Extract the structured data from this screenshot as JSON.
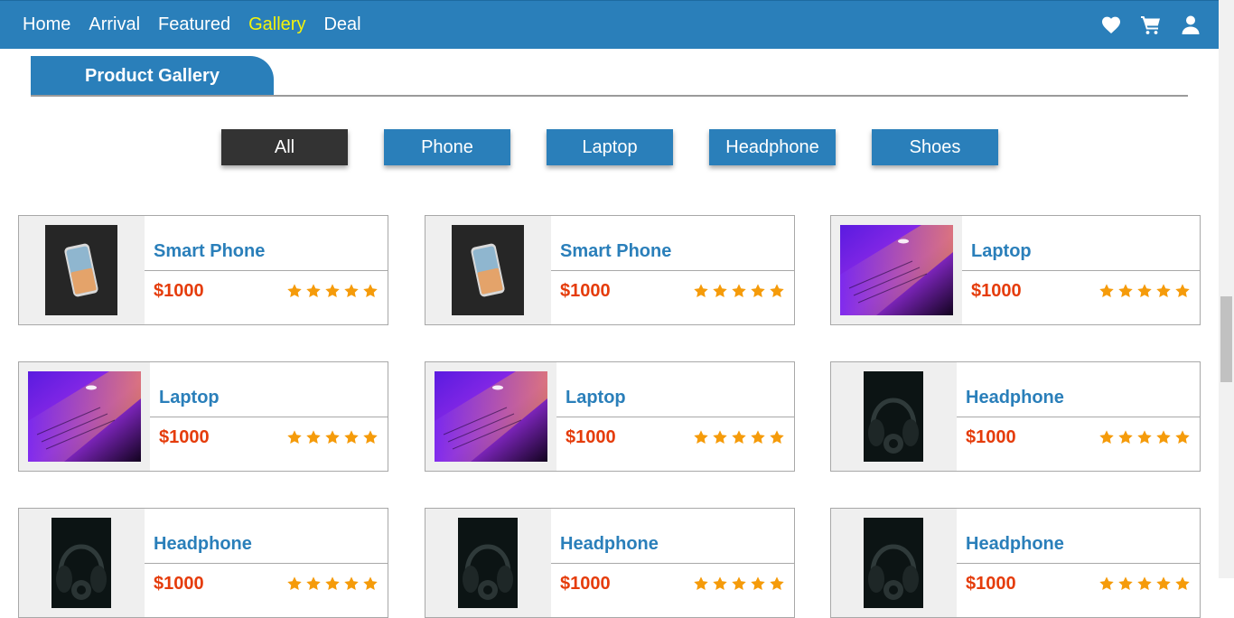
{
  "nav": {
    "links": [
      "Home",
      "Arrival",
      "Featured",
      "Gallery",
      "Deal"
    ],
    "active": "Gallery",
    "icons": [
      "heart-icon",
      "cart-icon",
      "user-icon"
    ]
  },
  "gallery": {
    "title": "Product Gallery"
  },
  "filters": {
    "items": [
      "All",
      "Phone",
      "Laptop",
      "Headphone",
      "Shoes"
    ],
    "active": "All"
  },
  "colors": {
    "brand": "#2a7fba",
    "active_nav": "#f3f30b",
    "price": "#e53c0b",
    "star": "#f59b0a",
    "dark_button": "#333333"
  },
  "products": [
    {
      "name": "Smart Phone",
      "price": "$1000",
      "rating": 5,
      "image": "phone"
    },
    {
      "name": "Smart Phone",
      "price": "$1000",
      "rating": 5,
      "image": "phone"
    },
    {
      "name": "Laptop",
      "price": "$1000",
      "rating": 5,
      "image": "laptop"
    },
    {
      "name": "Laptop",
      "price": "$1000",
      "rating": 5,
      "image": "laptop"
    },
    {
      "name": "Laptop",
      "price": "$1000",
      "rating": 5,
      "image": "laptop"
    },
    {
      "name": "Headphone",
      "price": "$1000",
      "rating": 5,
      "image": "headphone"
    },
    {
      "name": "Headphone",
      "price": "$1000",
      "rating": 5,
      "image": "headphone"
    },
    {
      "name": "Headphone",
      "price": "$1000",
      "rating": 5,
      "image": "headphone"
    },
    {
      "name": "Headphone",
      "price": "$1000",
      "rating": 5,
      "image": "headphone"
    }
  ]
}
